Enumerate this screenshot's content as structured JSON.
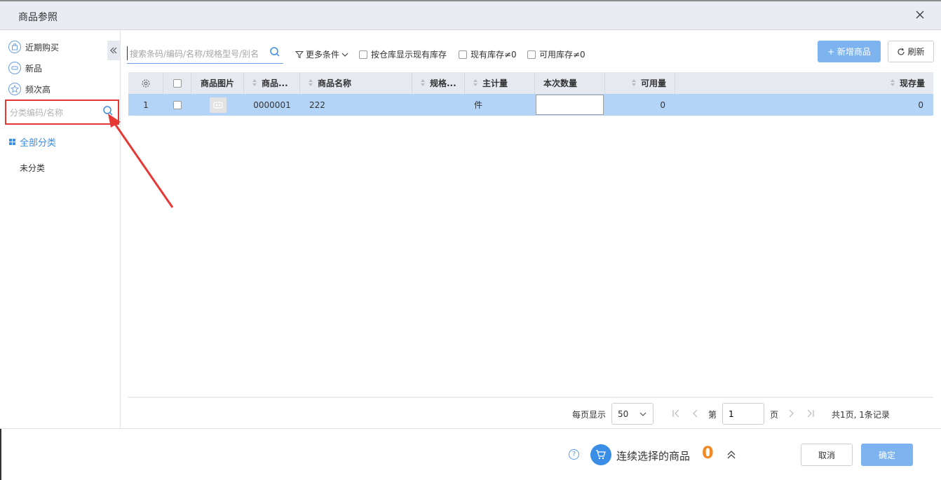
{
  "dialog": {
    "title": "商品参照"
  },
  "sidebar": {
    "quick_items": [
      {
        "label": "近期购买",
        "icon": "bag-icon"
      },
      {
        "label": "新品",
        "icon": "new-badge-icon"
      },
      {
        "label": "频次高",
        "icon": "star-icon"
      }
    ],
    "category_search_placeholder": "分类编码/名称",
    "all_categories_label": "全部分类",
    "categories": [
      "未分类"
    ]
  },
  "toolbar": {
    "search_placeholder": "搜索条码/编码/名称/规格型号/别名",
    "more_conditions_label": "更多条件",
    "checkboxes": [
      {
        "label": "按仓库显示现有库存",
        "checked": false
      },
      {
        "label": "现有库存≠0",
        "checked": false
      },
      {
        "label": "可用库存≠0",
        "checked": false
      }
    ],
    "new_product_label": "+ 新增商品",
    "refresh_label": "刷新"
  },
  "table": {
    "columns": [
      "商品图片",
      "商品...",
      "商品名称",
      "规格...",
      "主计量",
      "本次数量",
      "可用量",
      "现存量"
    ],
    "rows": [
      {
        "index": "1",
        "code": "0000001",
        "name": "222",
        "spec": "",
        "unit": "件",
        "qty": "",
        "available": "0",
        "stock": "0",
        "selected": true
      }
    ]
  },
  "pagination": {
    "per_page_label": "每页显示",
    "per_page_value": "50",
    "page_prefix": "第",
    "page_value": "1",
    "page_suffix": "页",
    "summary": "共1页, 1条记录"
  },
  "footer": {
    "cart_label": "连续选择的商品",
    "cart_count": "0",
    "cancel_label": "取消",
    "ok_label": "确定"
  },
  "colors": {
    "accent": "#3d8de0",
    "selected_row": "#b3d3f7",
    "highlight_border": "#e53935",
    "count": "#f08a24"
  }
}
